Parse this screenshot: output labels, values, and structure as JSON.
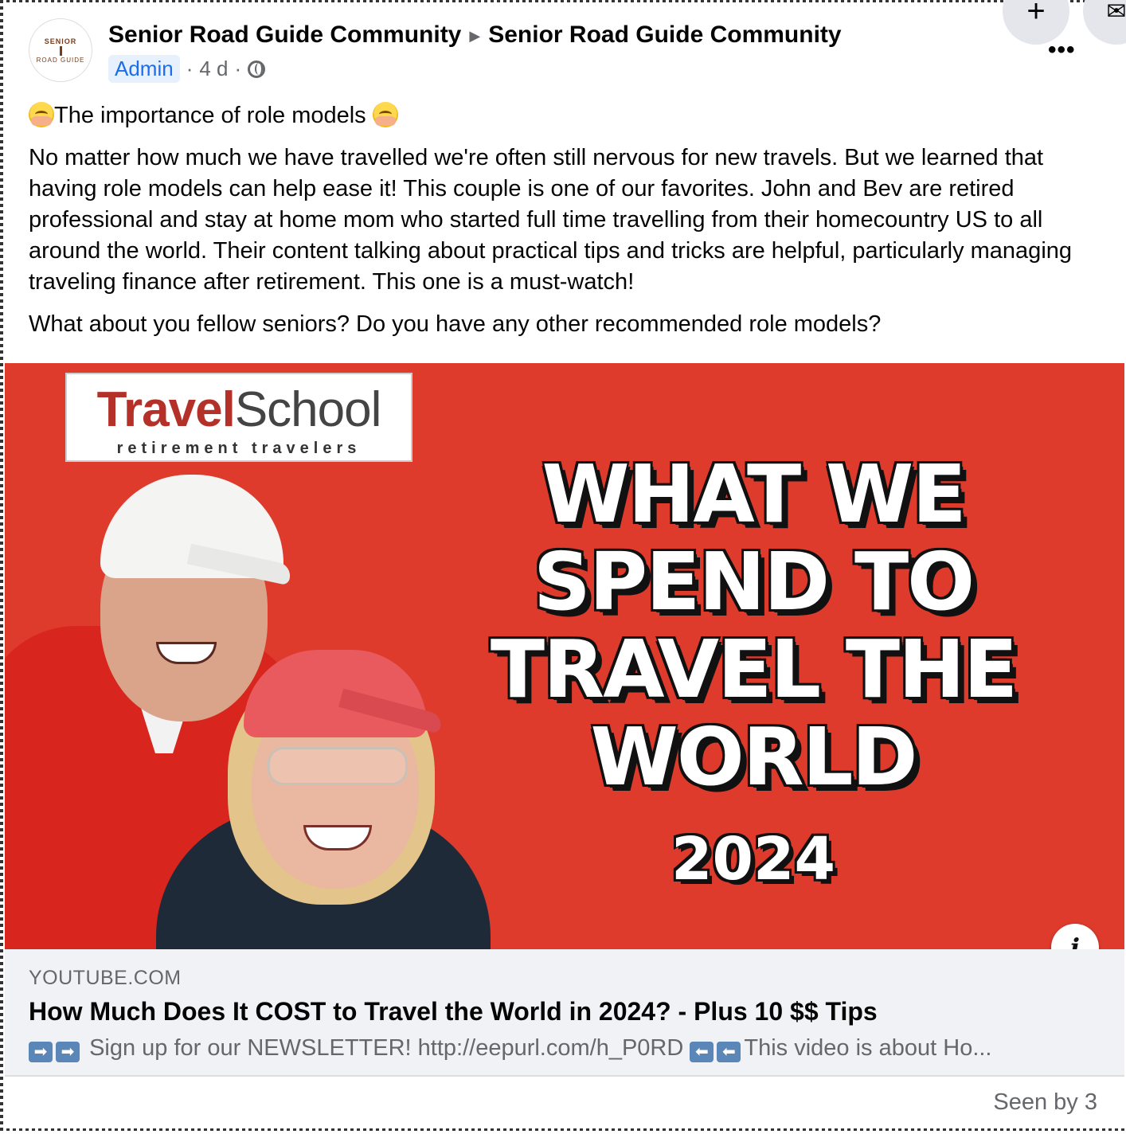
{
  "header": {
    "group_name": "Senior Road Guide Community",
    "page_name": "Senior Road Guide Community",
    "role_badge": "Admin",
    "time": "4 d",
    "separator": "·",
    "avatar_text_top": "SENIOR",
    "avatar_text_bottom": "ROAD GUIDE"
  },
  "controls": {
    "plus": "+",
    "more": "•••"
  },
  "post": {
    "title": "The importance of role models",
    "body": "No matter how much we have travelled we're often still nervous for new travels. But we learned that having role models can help ease it! This couple is one of our favorites. John and Bev are retired professional and stay at home mom who started full time travelling from their homecountry US to all around the world. Their content talking about practical tips and tricks are helpful, particularly managing traveling finance after retirement. This one is a must-watch!",
    "question": "What about you fellow seniors? Do you have any other recommended role models?"
  },
  "thumbnail": {
    "logo_part1": "Travel",
    "logo_part2": "School",
    "logo_sub": "retirement travelers",
    "headline": "WHAT WE SPEND TO TRAVEL THE WORLD",
    "year": "2024",
    "info_icon": "i"
  },
  "link": {
    "domain": "YOUTUBE.COM",
    "title": "How Much Does It COST to Travel the World in 2024? - Plus 10 $$ Tips",
    "desc_part1": "Sign up for our NEWSLETTER! http://eepurl.com/h_P0RD",
    "desc_part2": "This video is about Ho...",
    "arrow_right": "➡",
    "arrow_left": "⬅"
  },
  "footer": {
    "seen": "Seen by 3"
  }
}
